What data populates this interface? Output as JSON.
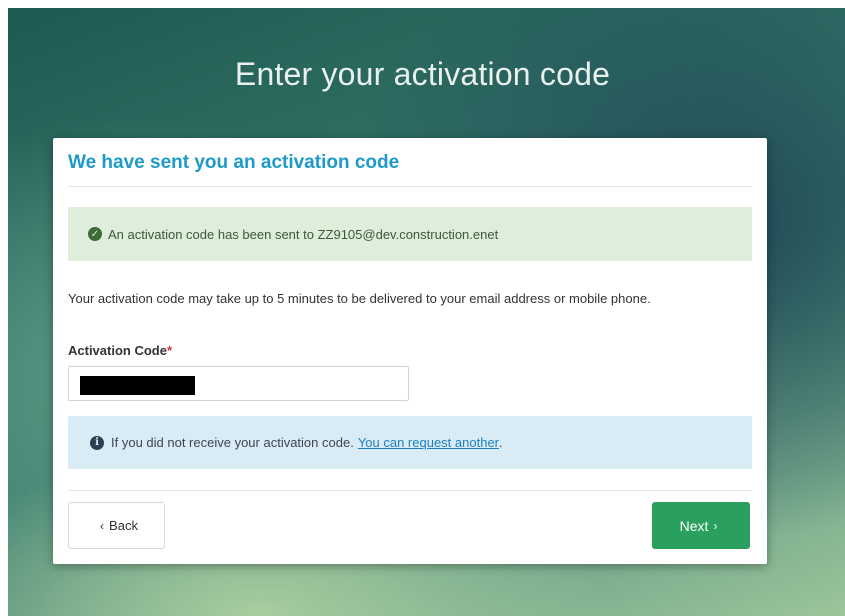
{
  "page": {
    "heading": "Enter your activation code"
  },
  "card": {
    "title": "We have sent you an activation code",
    "success_message": "An activation code has been sent to ZZ9105@dev.construction.enet",
    "description": "Your activation code may take up to 5 minutes to be delivered to your email address or mobile phone.",
    "field": {
      "label": "Activation Code",
      "required_mark": "*",
      "value": ""
    },
    "info_message": "If you did not receive your activation code.",
    "info_link": "You can request another",
    "info_period": ".",
    "back_label": "Back",
    "back_icon": "‹",
    "next_label": "Next",
    "next_icon": "›"
  },
  "icons": {
    "success": "check-circle-icon",
    "info": "info-circle-icon"
  },
  "colors": {
    "accent": "#1e9ac9",
    "primary_button": "#29a05e",
    "success_bg": "#dfeddb",
    "info_bg": "#d9ecf6",
    "required": "#d0342c"
  }
}
